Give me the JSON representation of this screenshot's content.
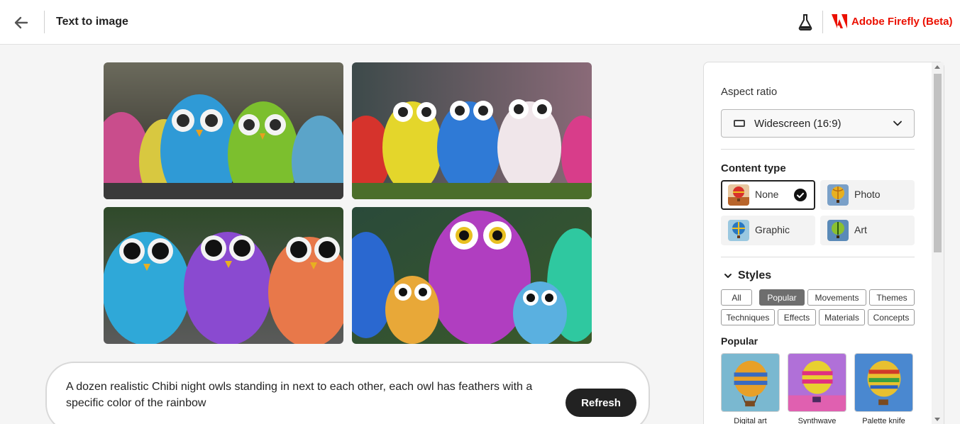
{
  "header": {
    "title": "Text to image",
    "brand": "Adobe Firefly (Beta)",
    "icons": {
      "back": "arrow-left-icon",
      "labs": "flask-icon",
      "logo": "adobe-logo-icon"
    },
    "brand_color": "#eb1000"
  },
  "gallery": {
    "images": [
      {
        "name": "owl-image-1",
        "icon": "generated-image"
      },
      {
        "name": "owl-image-2",
        "icon": "generated-image"
      },
      {
        "name": "owl-image-3",
        "icon": "generated-image"
      },
      {
        "name": "owl-image-4",
        "icon": "generated-image"
      }
    ]
  },
  "prompt": {
    "text": "A dozen realistic Chibi night owls standing in next to each other, each owl has feathers with a specific color of the rainbow",
    "refresh_label": "Refresh"
  },
  "panel": {
    "aspect_ratio": {
      "label": "Aspect ratio",
      "value": "Widescreen (16:9)"
    },
    "content_type": {
      "label": "Content type",
      "options": [
        {
          "label": "None",
          "selected": true
        },
        {
          "label": "Photo",
          "selected": false
        },
        {
          "label": "Graphic",
          "selected": false
        },
        {
          "label": "Art",
          "selected": false
        }
      ]
    },
    "styles": {
      "label": "Styles",
      "chips_row1": [
        "All",
        "Popular",
        "Movements",
        "Themes"
      ],
      "chips_row2": [
        "Techniques",
        "Effects",
        "Materials",
        "Concepts"
      ],
      "active_chip": "Popular",
      "section_label": "Popular",
      "cards": [
        "Digital art",
        "Synthwave",
        "Palette knife"
      ]
    }
  }
}
